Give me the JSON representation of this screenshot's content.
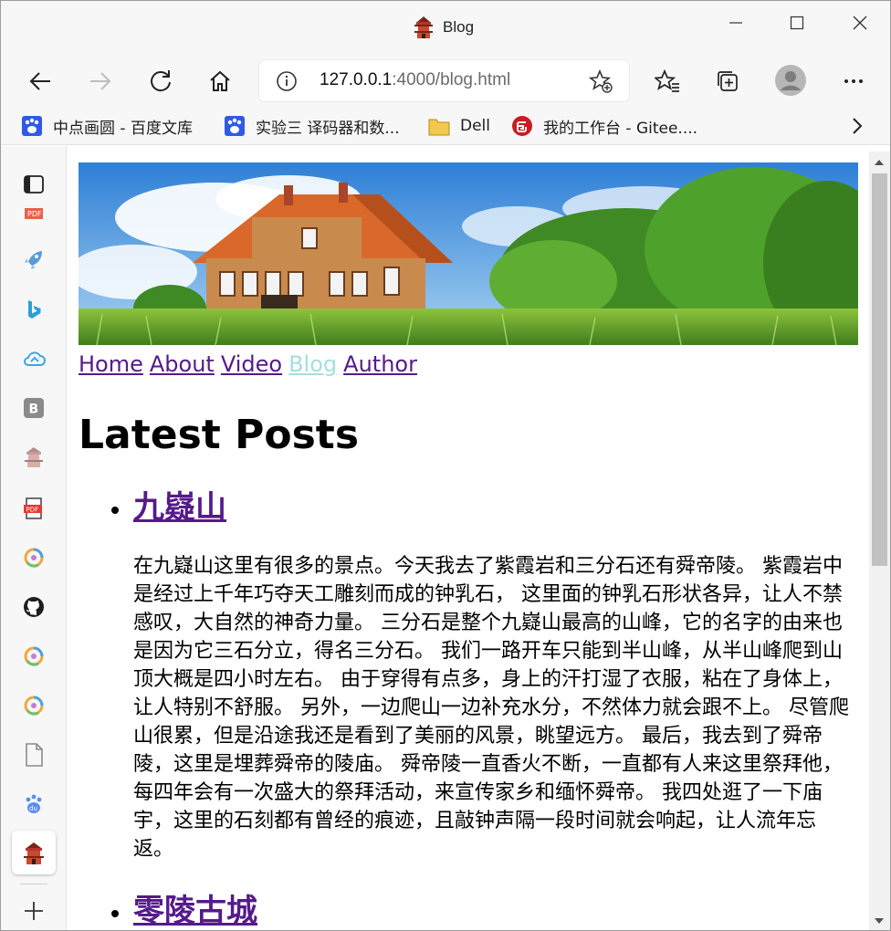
{
  "window": {
    "title": "Blog",
    "minimize_label": "Minimize",
    "maximize_label": "Maximize",
    "close_label": "Close"
  },
  "toolbar": {
    "url_host": "127.0.0.1",
    "url_rest": ":4000/blog.html"
  },
  "bookmarks": [
    {
      "label": "中点画圆 - 百度文库",
      "icon": "baidu-paw-icon"
    },
    {
      "label": "实验三 译码器和数...",
      "icon": "baidu-paw-icon"
    },
    {
      "label": "Dell",
      "icon": "folder-icon"
    },
    {
      "label": "我的工作台 - Gitee....",
      "icon": "gitee-icon"
    }
  ],
  "sidebar": {
    "items": [
      "tab-actions-icon",
      "pdf-icon",
      "rocket-icon",
      "bing-icon",
      "cloud-icon",
      "b-icon",
      "pagoda-icon",
      "pdf-icon",
      "circle-app-icon",
      "github-icon",
      "circle-app-icon",
      "circle-app-icon",
      "file-icon",
      "baidu-icon",
      "pagoda-icon",
      "add-icon"
    ]
  },
  "page": {
    "nav": {
      "home": "Home",
      "about": "About",
      "video": "Video",
      "blog": "Blog",
      "author": "Author"
    },
    "heading": "Latest Posts",
    "posts": [
      {
        "title": "九嶷山",
        "body": "在九嶷山这里有很多的景点。今天我去了紫霞岩和三分石还有舜帝陵。 紫霞岩中是经过上千年巧夺天工雕刻而成的钟乳石， 这里面的钟乳石形状各异，让人不禁感叹，大自然的神奇力量。 三分石是整个九嶷山最高的山峰，它的名字的由来也是因为它三石分立，得名三分石。 我们一路开车只能到半山峰，从半山峰爬到山顶大概是四小时左右。 由于穿得有点多，身上的汗打湿了衣服，粘在了身体上，让人特别不舒服。 另外，一边爬山一边补充水分，不然体力就会跟不上。 尽管爬山很累，但是沿途我还是看到了美丽的风景，眺望远方。 最后，我去到了舜帝陵，这里是埋葬舜帝的陵庙。 舜帝陵一直香火不断，一直都有人来这里祭拜他， 每四年会有一次盛大的祭拜活动，来宣传家乡和缅怀舜帝。 我四处逛了一下庙宇，这里的石刻都有曾经的痕迹，且敲钟声隔一段时间就会响起，让人流年忘返。"
      },
      {
        "title": "零陵古城"
      }
    ]
  },
  "colors": {
    "link_visited": "#551a8b",
    "link_current": "#a6dede",
    "chrome_bg": "#f7f7f7"
  }
}
